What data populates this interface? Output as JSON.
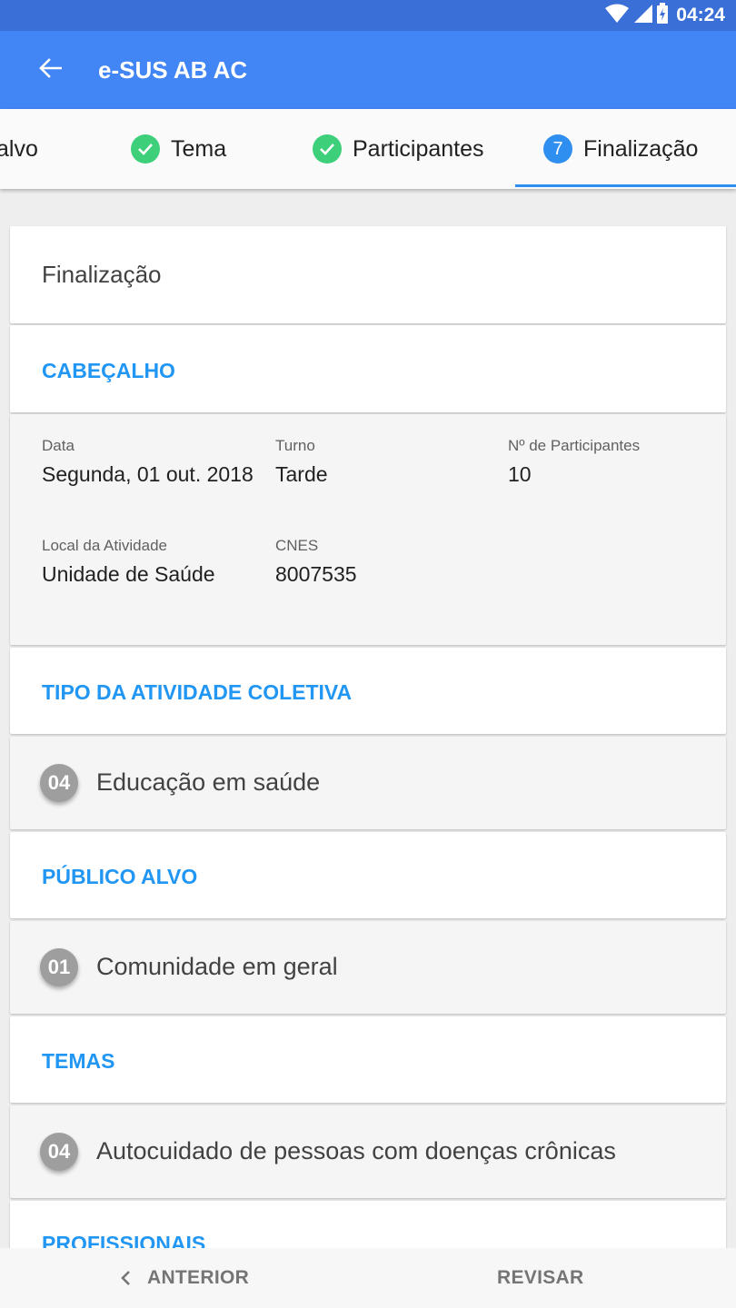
{
  "status_bar": {
    "time": "04:24",
    "icons": [
      "wifi-icon",
      "signal-icon",
      "battery-charging-icon"
    ]
  },
  "app_bar": {
    "title": "e-SUS AB AC",
    "back_icon": "arrow-left-icon"
  },
  "stepper": {
    "steps": [
      {
        "label": "alvo",
        "state": "done"
      },
      {
        "label": "Tema",
        "state": "done"
      },
      {
        "label": "Participantes",
        "state": "done"
      },
      {
        "label": "Finalização",
        "state": "active",
        "number": "7"
      }
    ]
  },
  "summary": {
    "title": "Finalização",
    "header_section": {
      "heading": "CABEÇALHO",
      "fields": {
        "data": {
          "label": "Data",
          "value": "Segunda, 01 out. 2018"
        },
        "turno": {
          "label": "Turno",
          "value": "Tarde"
        },
        "participantes": {
          "label": "Nº de Participantes",
          "value": "10"
        },
        "local": {
          "label": "Local da Atividade",
          "value": "Unidade de Saúde"
        },
        "cnes": {
          "label": "CNES",
          "value": "8007535"
        }
      }
    },
    "tipo_section": {
      "heading": "TIPO DA ATIVIDADE COLETIVA",
      "item": {
        "code": "04",
        "text": "Educação em saúde"
      }
    },
    "publico_section": {
      "heading": "PÚBLICO ALVO",
      "item": {
        "code": "01",
        "text": "Comunidade em geral"
      }
    },
    "temas_section": {
      "heading": "TEMAS",
      "item": {
        "code": "04",
        "text": "Autocuidado de pessoas com doenças crônicas"
      }
    },
    "profissionais_section": {
      "heading": "PROFISSIONAIS"
    }
  },
  "bottom_nav": {
    "previous_label": "ANTERIOR",
    "review_label": "REVISAR"
  },
  "colors": {
    "status_bar": "#3b6fd8",
    "app_bar": "#4285f4",
    "accent": "#2196f3",
    "step_done": "#3ecf7a",
    "badge": "#9e9e9e"
  }
}
